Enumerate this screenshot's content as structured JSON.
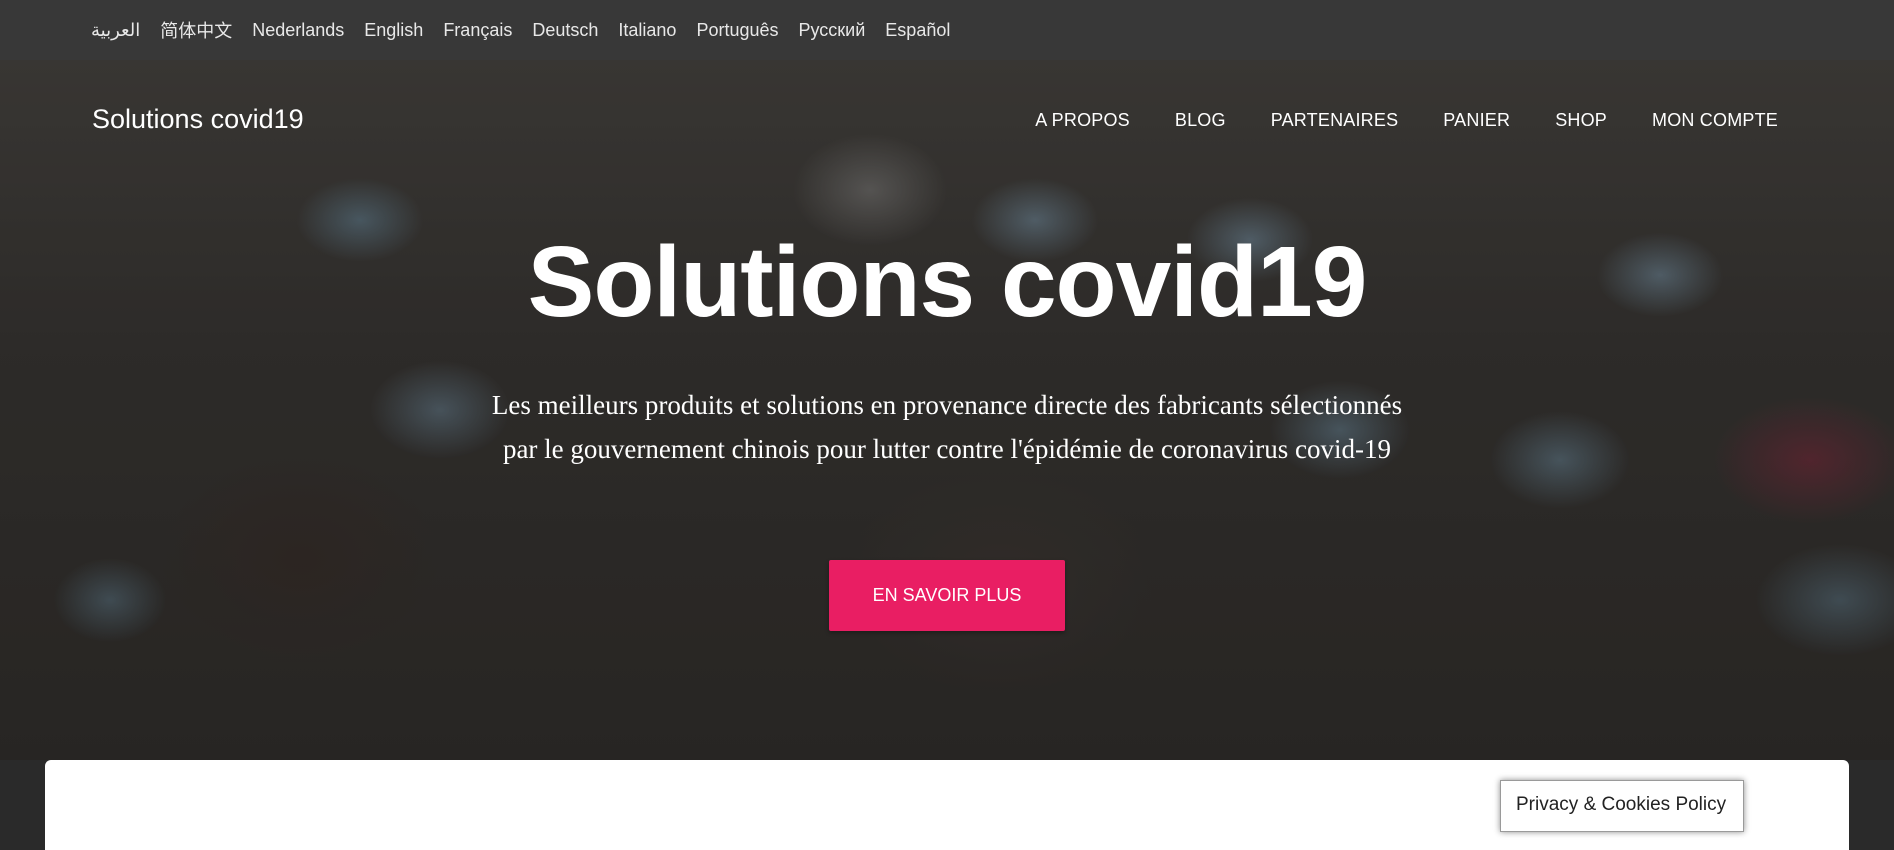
{
  "languages": [
    "العربية",
    "简体中文",
    "Nederlands",
    "English",
    "Français",
    "Deutsch",
    "Italiano",
    "Português",
    "Русский",
    "Español"
  ],
  "header": {
    "brand": "Solutions covid19",
    "nav": [
      "A PROPOS",
      "BLOG",
      "PARTENAIRES",
      "PANIER",
      "SHOP",
      "MON COMPTE"
    ]
  },
  "hero": {
    "title": "Solutions covid19",
    "subtitle_line1": "Les meilleurs produits et solutions en provenance directe des fabricants sélectionnés",
    "subtitle_line2": "par le gouvernement chinois pour lutter contre l'épidémie de coronavirus covid-19",
    "cta_label": "EN SAVOIR PLUS"
  },
  "privacy_label": "Privacy & Cookies Policy",
  "colors": {
    "accent": "#e91e63",
    "topbar": "#383838"
  }
}
